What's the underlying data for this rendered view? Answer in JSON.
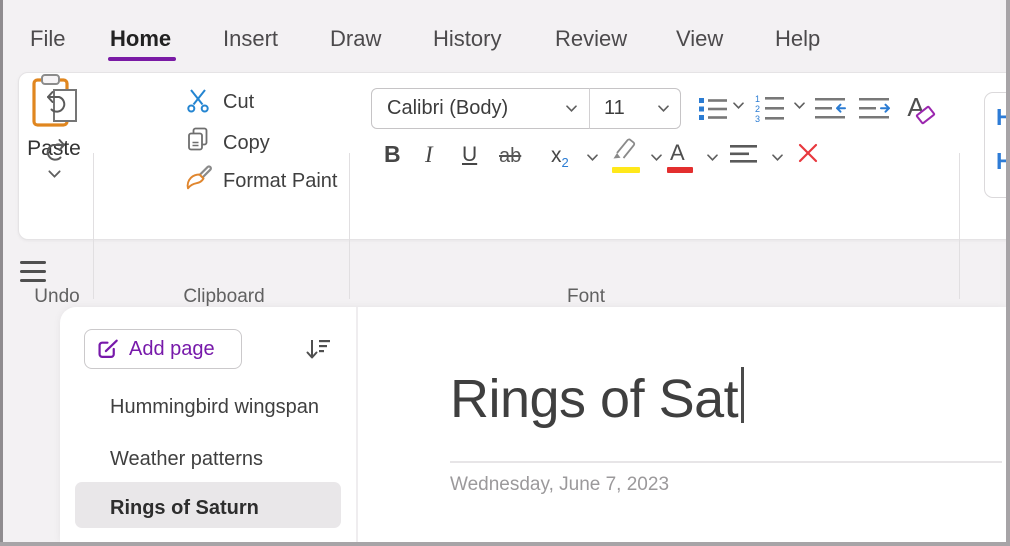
{
  "menu": {
    "items": [
      {
        "label": "File",
        "active": false
      },
      {
        "label": "Home",
        "active": true
      },
      {
        "label": "Insert",
        "active": false
      },
      {
        "label": "Draw",
        "active": false
      },
      {
        "label": "History",
        "active": false
      },
      {
        "label": "Review",
        "active": false
      },
      {
        "label": "View",
        "active": false
      },
      {
        "label": "Help",
        "active": false
      }
    ]
  },
  "ribbon": {
    "undo_group": {
      "label": "Undo"
    },
    "clipboard_group": {
      "label": "Clipboard",
      "paste_label": "Paste",
      "cut_label": "Cut",
      "copy_label": "Copy",
      "format_paint_label": "Format Paint"
    },
    "font_group": {
      "label": "Font",
      "font_name": "Calibri (Body)",
      "font_size": "11",
      "bold": "B",
      "italic": "I",
      "underline": "U",
      "strikethrough": "ab",
      "subscript_base": "x",
      "subscript_sub": "2",
      "font_color_letter": "A",
      "clear_format_letter": "A"
    },
    "styles_group": {
      "entries": [
        "H",
        "H"
      ]
    }
  },
  "sidebar": {
    "add_page_label": "Add page",
    "pages": [
      {
        "title": "Hummingbird wingspan",
        "selected": false
      },
      {
        "title": "Weather patterns",
        "selected": false
      },
      {
        "title": "Rings of Saturn",
        "selected": true
      }
    ]
  },
  "page": {
    "title": "Rings of Sat",
    "date": "Wednesday, June 7, 2023"
  },
  "icons": {
    "undo": "curved-arrow-counterclockwise",
    "redo": "curved-arrow-clockwise",
    "paste": "clipboard-with-page",
    "cut": "scissors",
    "copy": "two-documents",
    "format_paint": "paintbrush",
    "bullets": "bulleted-list",
    "numbering": "numbered-list",
    "decrease_indent": "lines-arrow-left",
    "increase_indent": "lines-arrow-right",
    "clear_formatting": "letter-a-with-eraser",
    "highlight": "highlighter-pen-yellow",
    "font_color": "letter-a-red-bar",
    "align": "align-left-lines",
    "delete": "red-x",
    "add_page": "compose-square-pen",
    "sort": "arrow-down-with-lines",
    "menu": "hamburger"
  },
  "colors": {
    "accent_purple": "#7719aa",
    "icon_blue": "#2b7cd3",
    "red": "#e8383e",
    "highlight_yellow": "#ffe81a",
    "paste_orange": "#e0861f",
    "selected_page_bg": "#e9e7e9",
    "window_bg": "#f3f1f3"
  }
}
